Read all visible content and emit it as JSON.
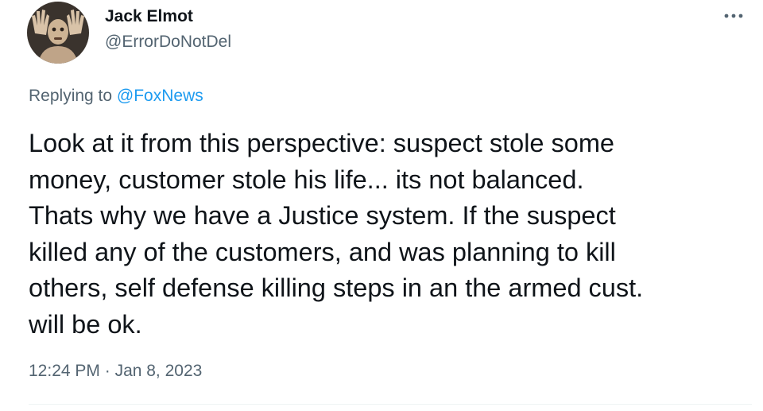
{
  "author": {
    "display_name": "Jack Elmot",
    "handle": "@ErrorDoNotDel",
    "avatar_icon": "user-avatar"
  },
  "menu": {
    "icon": "more-horizontal-icon"
  },
  "reply": {
    "prefix": "Replying to ",
    "mention": "@FoxNews"
  },
  "tweet": {
    "text": "Look at it from this perspective: suspect stole some\nmoney, customer stole his life... its not balanced.\nThats why we have a  Justice system. If the suspect\nkilled any of the customers, and was planning to kill\nothers, self defense killing steps in an the armed cust.\nwill be ok."
  },
  "meta": {
    "time": "12:24 PM",
    "separator": " · ",
    "date": "Jan 8, 2023"
  },
  "colors": {
    "text_primary": "#0f1419",
    "text_secondary": "#536471",
    "link": "#1d9bf0",
    "divider": "#eff3f4"
  }
}
